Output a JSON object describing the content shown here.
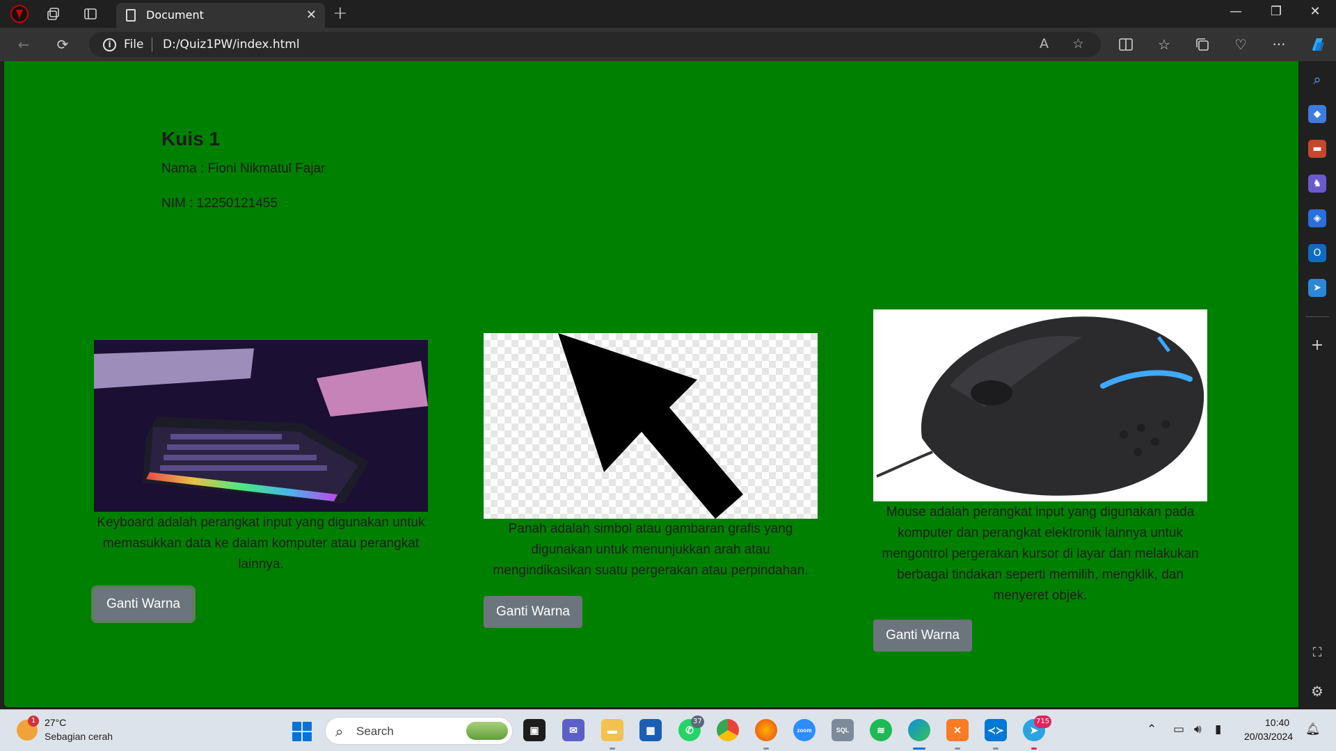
{
  "browser": {
    "tab_title": "Document",
    "address_scheme": "File",
    "address_url": "D:/Quiz1PW/index.html"
  },
  "page": {
    "title": "Kuis 1",
    "name_line": "Nama : Fioni Nikmatul Fajar",
    "nim_line": "NIM : 12250121455",
    "background_color": "#008000",
    "cards": [
      {
        "image_subject": "keyboard",
        "description": "Keyboard adalah perangkat input yang digunakan untuk memasukkan data ke dalam komputer atau perangkat lainnya.",
        "button_label": "Ganti Warna"
      },
      {
        "image_subject": "arrow",
        "description": "Panah adalah simbol atau gambaran grafis yang digunakan untuk menunjukkan arah atau mengindikasikan suatu pergerakan atau perpindahan.",
        "button_label": "Ganti Warna"
      },
      {
        "image_subject": "mouse",
        "description": "Mouse adalah perangkat input yang digunakan pada komputer dan perangkat elektronik lainnya untuk mengontrol pergerakan kursor di layar dan melakukan berbagai tindakan seperti memilih, mengklik, dan menyeret objek.",
        "button_label": "Ganti Warna"
      }
    ],
    "button_color": "#6c757d"
  },
  "taskbar": {
    "weather_temp": "27°C",
    "weather_desc": "Sebagian cerah",
    "weather_badge": "1",
    "search_placeholder": "Search",
    "whatsapp_badge": "37",
    "telegram_badge": "715",
    "time": "10:40",
    "date": "20/03/2024"
  }
}
